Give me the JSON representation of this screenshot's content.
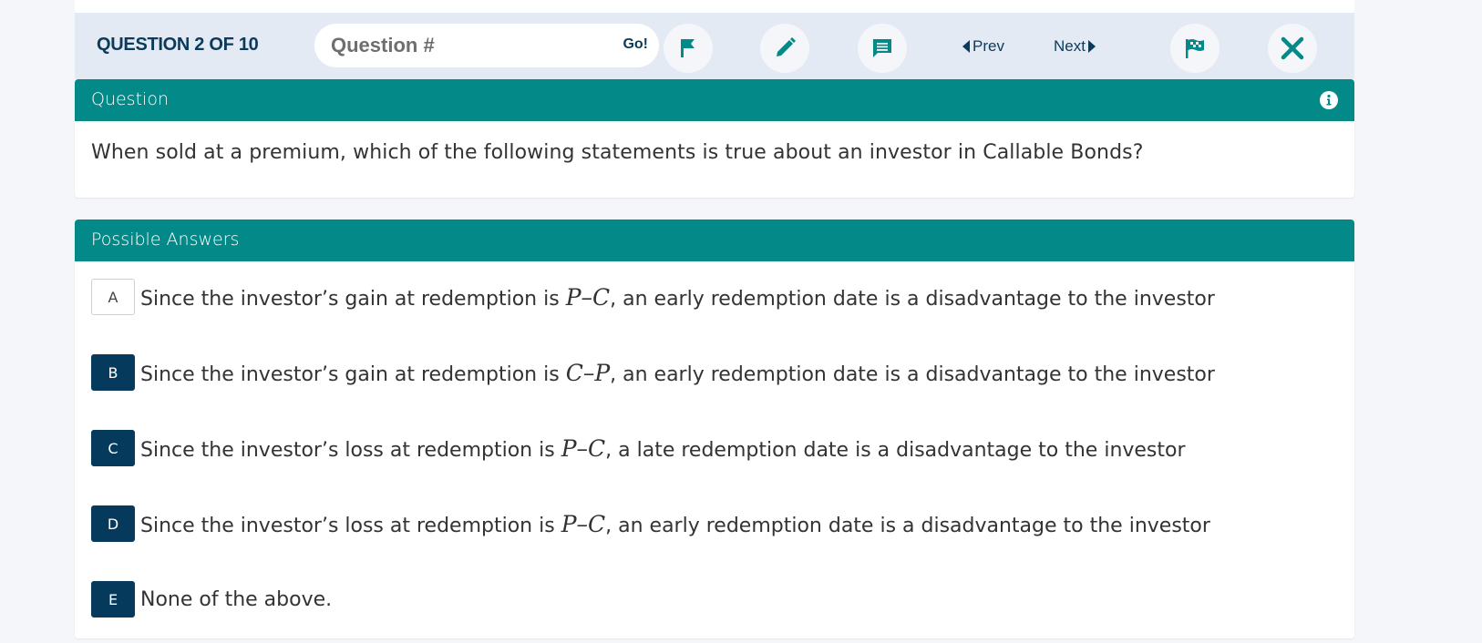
{
  "toolbar": {
    "counter": "QUESTION 2 OF 10",
    "search_placeholder": "Question #",
    "search_value": "",
    "go_label": "Go!",
    "prev_label": "Prev",
    "next_label": "Next",
    "icons": {
      "flag": "flag-icon",
      "pencil": "pencil-icon",
      "comment": "comment-icon",
      "finish": "checkered-flag-icon",
      "close": "close-icon"
    },
    "accent_color": "#038a88"
  },
  "question_panel": {
    "header": "Question",
    "info_icon": "info-icon",
    "text": "When sold at a premium, which of the following statements is true about an investor in Callable Bonds?"
  },
  "answers_panel": {
    "header": "Possible Answers",
    "answers": [
      {
        "letter": "A",
        "pre": "Since the investor’s gain at redemption is ",
        "math": "P–C",
        "post": ", an early redemption date is a disadvantage to the investor",
        "selected": false
      },
      {
        "letter": "B",
        "pre": "Since the investor’s gain at redemption is ",
        "math": "C–P",
        "post": ", an early redemption date is a disadvantage to the investor",
        "selected": true
      },
      {
        "letter": "C",
        "pre": "Since the investor’s loss at redemption is ",
        "math": "P–C",
        "post": ", a late redemption date is a disadvantage to the investor",
        "selected": true
      },
      {
        "letter": "D",
        "pre": "Since the investor’s loss at redemption is ",
        "math": "P–C",
        "post": ", an early redemption date is a disadvantage to the investor",
        "selected": true
      },
      {
        "letter": "E",
        "pre": "None of the above.",
        "math": "",
        "post": "",
        "selected": true
      }
    ]
  },
  "colors": {
    "header_teal": "#038a88",
    "letter_navy": "#053a5d",
    "toolbar_bg": "#e4eaf4"
  }
}
